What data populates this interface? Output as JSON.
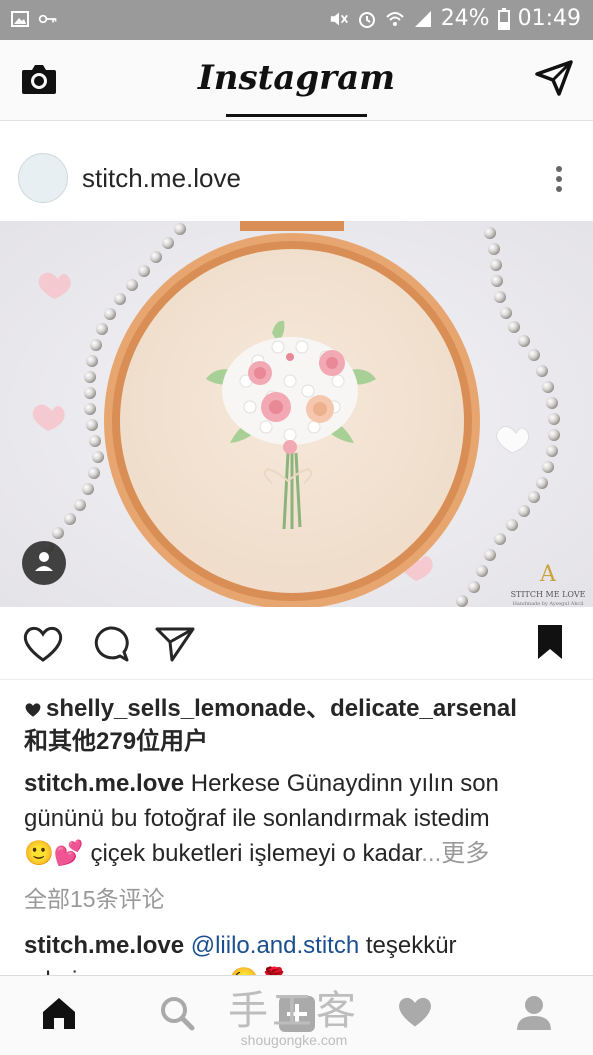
{
  "status_bar": {
    "battery": "24%",
    "time": "01:49"
  },
  "header": {
    "logo": "Instagram"
  },
  "post": {
    "username": "stitch.me.love",
    "image_watermark": {
      "brand": "STITCH ME LOVE",
      "tagline": "Handmade by Aysegul Akcil"
    },
    "likes_text": "shelly_sells_lemonade、delicate_arsenal",
    "likes_text2": "和其他279位用户",
    "caption_user": "stitch.me.love",
    "caption_line1": "Herkese Günaydinn yılın son",
    "caption_line2": "gününü bu fotoğraf ile sonlandırmak istedim",
    "caption_line3_emoji": "🙂💕",
    "caption_line3": "çiçek buketleri işlemeyi o kadar",
    "ellipsis": "...",
    "more_label": "更多",
    "view_all_comments": "全部15条评论",
    "comment": {
      "user": "stitch.me.love",
      "mention": "@liilo.and.stitch",
      "text": "teşekkür",
      "text_line2": "ederimmmm canım😉🌹"
    }
  },
  "watermark": {
    "cn": "手工客",
    "en": "shougongke.com"
  },
  "icons": [
    "camera-icon",
    "direct-send-icon",
    "more-vert-icon",
    "user-tag-icon",
    "heart-icon",
    "comment-icon",
    "share-icon",
    "bookmark-icon",
    "home-icon",
    "search-icon",
    "add-icon",
    "activity-heart-icon",
    "profile-icon"
  ],
  "colors": {
    "status_bar": "#9a9a9a",
    "mention": "#1b4f8f",
    "muted": "#999999"
  }
}
